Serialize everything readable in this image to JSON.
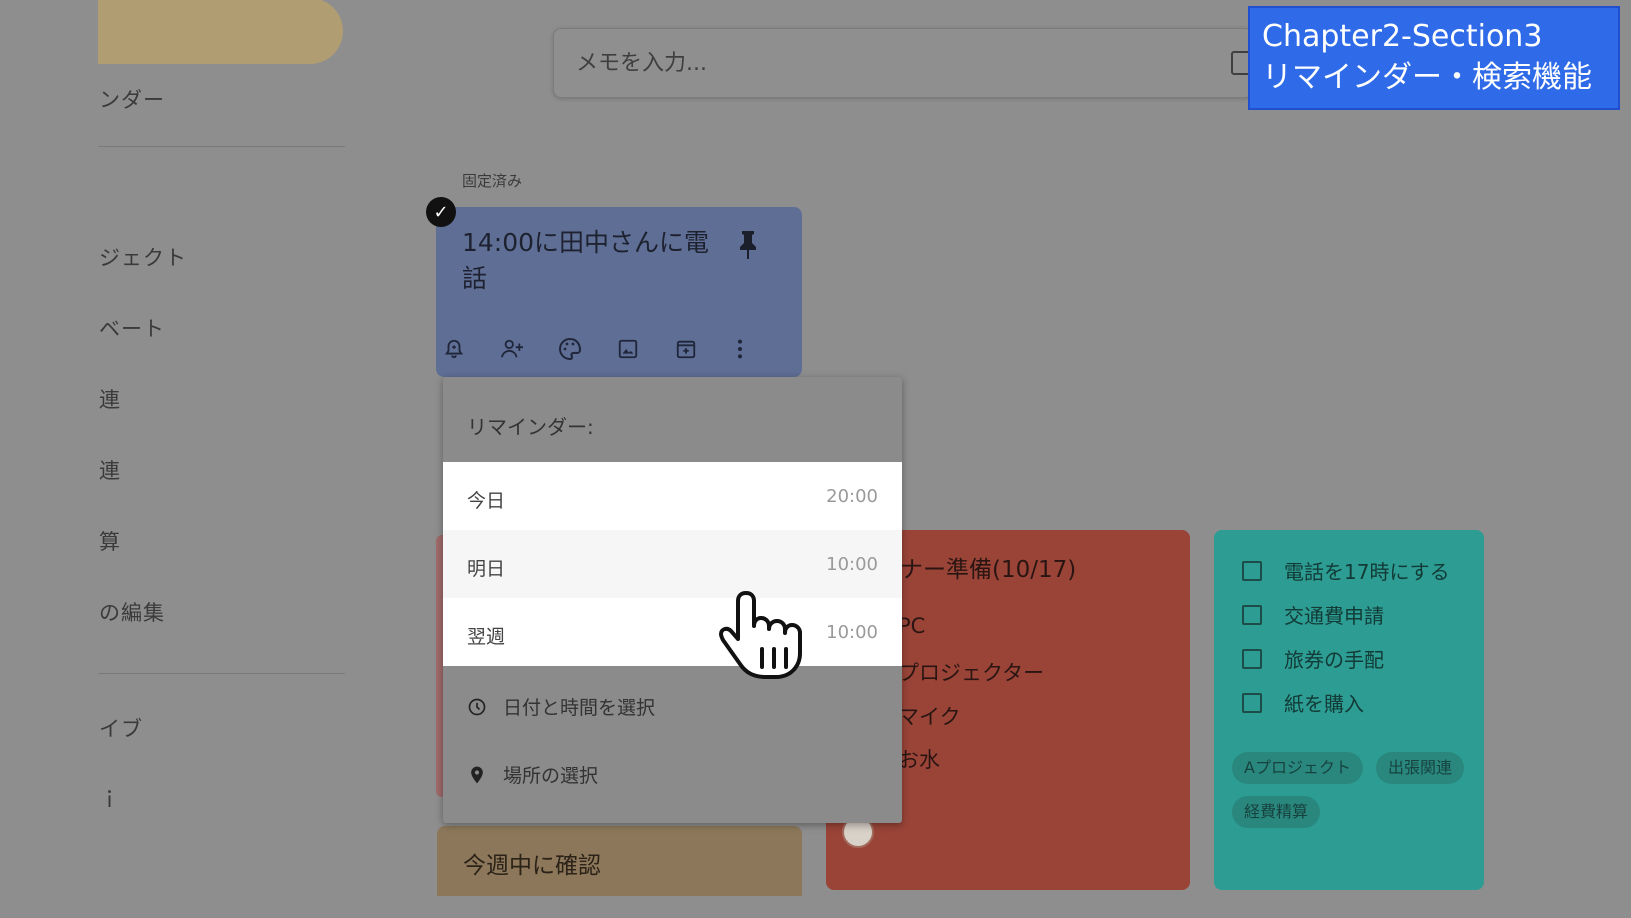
{
  "sidebar": {
    "items": [
      {
        "label": "ンダー"
      },
      {
        "label": "ジェクト"
      },
      {
        "label": "ベート"
      },
      {
        "label": "連"
      },
      {
        "label": "連"
      },
      {
        "label": "算"
      },
      {
        "label": "の編集"
      },
      {
        "label": "イブ"
      },
      {
        "label": "ｉ"
      }
    ]
  },
  "search": {
    "placeholder": "メモを入力..."
  },
  "overlay": {
    "line1": "Chapter2-Section3",
    "line2": "リマインダー・検索機能"
  },
  "pinned": {
    "label": "固定済み",
    "note": {
      "title": "14:00に田中さんに電話",
      "toolbar": [
        "bell-icon",
        "add-person-icon",
        "palette-icon",
        "image-icon",
        "archive-icon",
        "more-icon"
      ]
    }
  },
  "reminder_popup": {
    "title": "リマインダー:",
    "options": [
      {
        "label": "今日",
        "time": "20:00"
      },
      {
        "label": "明日",
        "time": "10:00"
      },
      {
        "label": "翌週",
        "time": "10:00"
      }
    ],
    "pick_datetime": "日付と時間を選択",
    "pick_place": "場所の選択"
  },
  "notes": {
    "red": {
      "title": "ナー準備(10/17)",
      "items": [
        "PC",
        "プロジェクター",
        "マイク",
        "お水"
      ]
    },
    "teal": {
      "items": [
        "電話を17時にする",
        "交通費申請",
        "旅券の手配",
        "紙を購入"
      ],
      "labels": [
        "Aプロジェクト",
        "出張関連",
        "経費精算"
      ]
    },
    "sand": {
      "title": "今週中に確認"
    }
  },
  "colors": {
    "background": "#8e8e8e",
    "note_blue": "#5e6e95",
    "note_red": "#9a4438",
    "note_teal": "#2d9c92",
    "note_sand": "#8c775a",
    "overlay": "#2f6be8"
  }
}
